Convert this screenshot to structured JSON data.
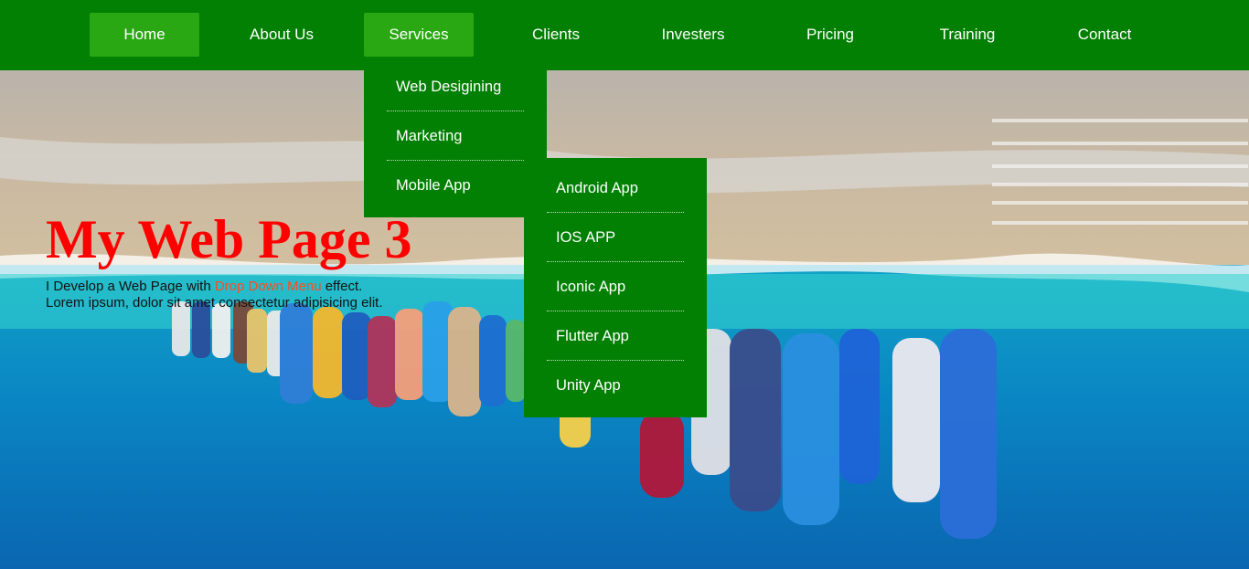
{
  "nav": {
    "items": [
      {
        "label": "Home",
        "active": true
      },
      {
        "label": "About Us",
        "active": false
      },
      {
        "label": "Services",
        "active": true
      },
      {
        "label": "Clients",
        "active": false
      },
      {
        "label": "Investers",
        "active": false
      },
      {
        "label": "Pricing",
        "active": false
      },
      {
        "label": "Training",
        "active": false
      },
      {
        "label": "Contact",
        "active": false
      }
    ]
  },
  "services_menu": {
    "items": [
      "Web Desigining",
      "Marketing",
      "Mobile App"
    ]
  },
  "mobile_submenu": {
    "items": [
      "Android App",
      "IOS APP",
      "Iconic App",
      "Flutter App",
      "Unity App"
    ]
  },
  "hero": {
    "title": "My Web Page 3",
    "text_before": "I Develop a Web Page with ",
    "highlight": "Drop Down Menu",
    "text_after": " effect. Lorem ipsum, dolor sit amet consectetur adipisicing elit."
  },
  "colors": {
    "nav_bg": "#028003",
    "nav_active": "#2aa814",
    "title": "#ff0000",
    "highlight": "#ff4b1f"
  }
}
